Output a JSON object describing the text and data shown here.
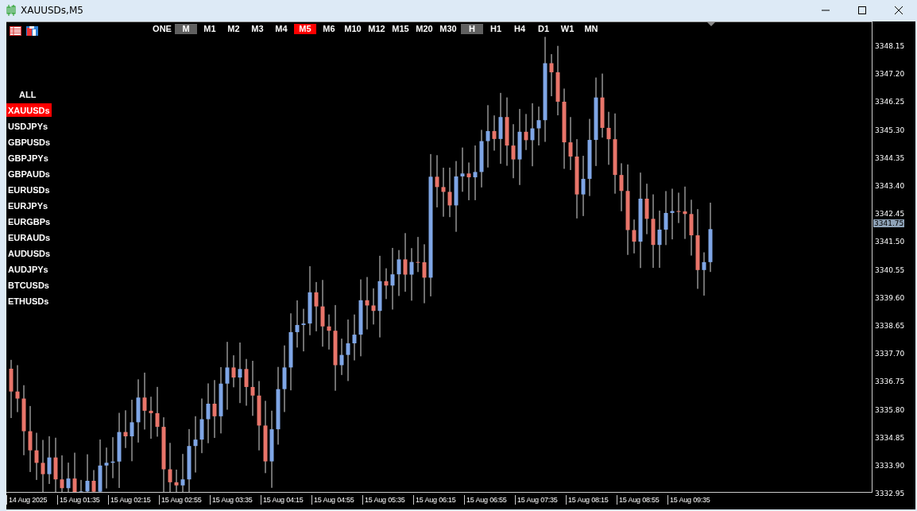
{
  "window": {
    "title": "XAUUSDs,M5"
  },
  "timeframes": [
    {
      "label": "ONE",
      "kind": "period",
      "selected": false
    },
    {
      "label": "M",
      "kind": "group",
      "selected": false
    },
    {
      "label": "M1",
      "kind": "period",
      "selected": false
    },
    {
      "label": "M2",
      "kind": "period",
      "selected": false
    },
    {
      "label": "M3",
      "kind": "period",
      "selected": false
    },
    {
      "label": "M4",
      "kind": "period",
      "selected": false
    },
    {
      "label": "M5",
      "kind": "period",
      "selected": true
    },
    {
      "label": "M6",
      "kind": "period",
      "selected": false
    },
    {
      "label": "M10",
      "kind": "period",
      "selected": false
    },
    {
      "label": "M12",
      "kind": "period",
      "selected": false
    },
    {
      "label": "M15",
      "kind": "period",
      "selected": false
    },
    {
      "label": "M20",
      "kind": "period",
      "selected": false
    },
    {
      "label": "M30",
      "kind": "period",
      "selected": false
    },
    {
      "label": "H",
      "kind": "group",
      "selected": false
    },
    {
      "label": "H1",
      "kind": "period",
      "selected": false
    },
    {
      "label": "H4",
      "kind": "period",
      "selected": false
    },
    {
      "label": "D1",
      "kind": "period",
      "selected": false
    },
    {
      "label": "W1",
      "kind": "period",
      "selected": false
    },
    {
      "label": "MN",
      "kind": "period",
      "selected": false
    }
  ],
  "symbols": {
    "all_label": "ALL",
    "items": [
      {
        "label": "XAUUSDs",
        "selected": true
      },
      {
        "label": "USDJPYs",
        "selected": false
      },
      {
        "label": "GBPUSDs",
        "selected": false
      },
      {
        "label": "GBPJPYs",
        "selected": false
      },
      {
        "label": "GBPAUDs",
        "selected": false
      },
      {
        "label": "EURUSDs",
        "selected": false
      },
      {
        "label": "EURJPYs",
        "selected": false
      },
      {
        "label": "EURGBPs",
        "selected": false
      },
      {
        "label": "EURAUDs",
        "selected": false
      },
      {
        "label": "AUDUSDs",
        "selected": false
      },
      {
        "label": "AUDJPYs",
        "selected": false
      },
      {
        "label": "BTCUSDs",
        "selected": false
      },
      {
        "label": "ETHUSDs",
        "selected": false
      }
    ]
  },
  "price_axis": {
    "labels": [
      "3348.15",
      "3347.20",
      "3346.25",
      "3345.30",
      "3344.35",
      "3343.40",
      "3342.45",
      "3341.50",
      "3340.55",
      "3339.60",
      "3338.65",
      "3337.70",
      "3336.75",
      "3335.80",
      "3334.85",
      "3333.90",
      "3332.95"
    ],
    "current_price": "3341.75"
  },
  "time_axis": {
    "labels": [
      "14 Aug 2025",
      "15 Aug 01:35",
      "15 Aug 02:15",
      "15 Aug 02:55",
      "15 Aug 03:35",
      "15 Aug 04:15",
      "15 Aug 04:55",
      "15 Aug 05:35",
      "15 Aug 06:15",
      "15 Aug 06:55",
      "15 Aug 07:35",
      "15 Aug 08:15",
      "15 Aug 08:55",
      "15 Aug 09:35"
    ]
  }
}
